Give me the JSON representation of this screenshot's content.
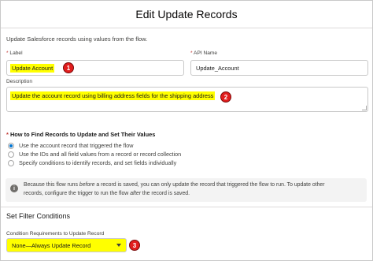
{
  "modal": {
    "title": "Edit Update Records",
    "description": "Update Salesforce records using values from the flow."
  },
  "label_field": {
    "label": "Label",
    "required_mark": "*",
    "value": "Update Account",
    "badge": "1"
  },
  "api_name_field": {
    "label": "API Name",
    "required_mark": "*",
    "value": "Update_Account"
  },
  "description_field": {
    "label": "Description",
    "value": "Update the account record using billing address fields for the shipping address",
    "badge": "2"
  },
  "find_records": {
    "required_mark": "*",
    "title": "How to Find Records to Update and Set Their Values",
    "options": [
      {
        "label": "Use the account record that triggered the flow",
        "selected": true
      },
      {
        "label": "Use the IDs and all field values from a record or record collection",
        "selected": false
      },
      {
        "label": "Specify conditions to identify records, and set fields individually",
        "selected": false
      }
    ]
  },
  "info_box": {
    "icon": "info-icon",
    "line1_pre": "Because this flow runs ",
    "line1_em": "before",
    "line1_post": " a record is saved, you can only update the record that triggered the flow to run. To update other",
    "line2_pre": "records, configure the trigger to run the flow ",
    "line2_em": "after",
    "line2_post": " the record is saved."
  },
  "filter": {
    "title": "Set Filter Conditions",
    "condition_label": "Condition Requirements to Update Record",
    "selected": "None—Always Update Record",
    "badge": "3"
  },
  "colors": {
    "highlight": "#ffff00",
    "badge": "#e11d1d",
    "radio_selected": "#0176d3"
  }
}
